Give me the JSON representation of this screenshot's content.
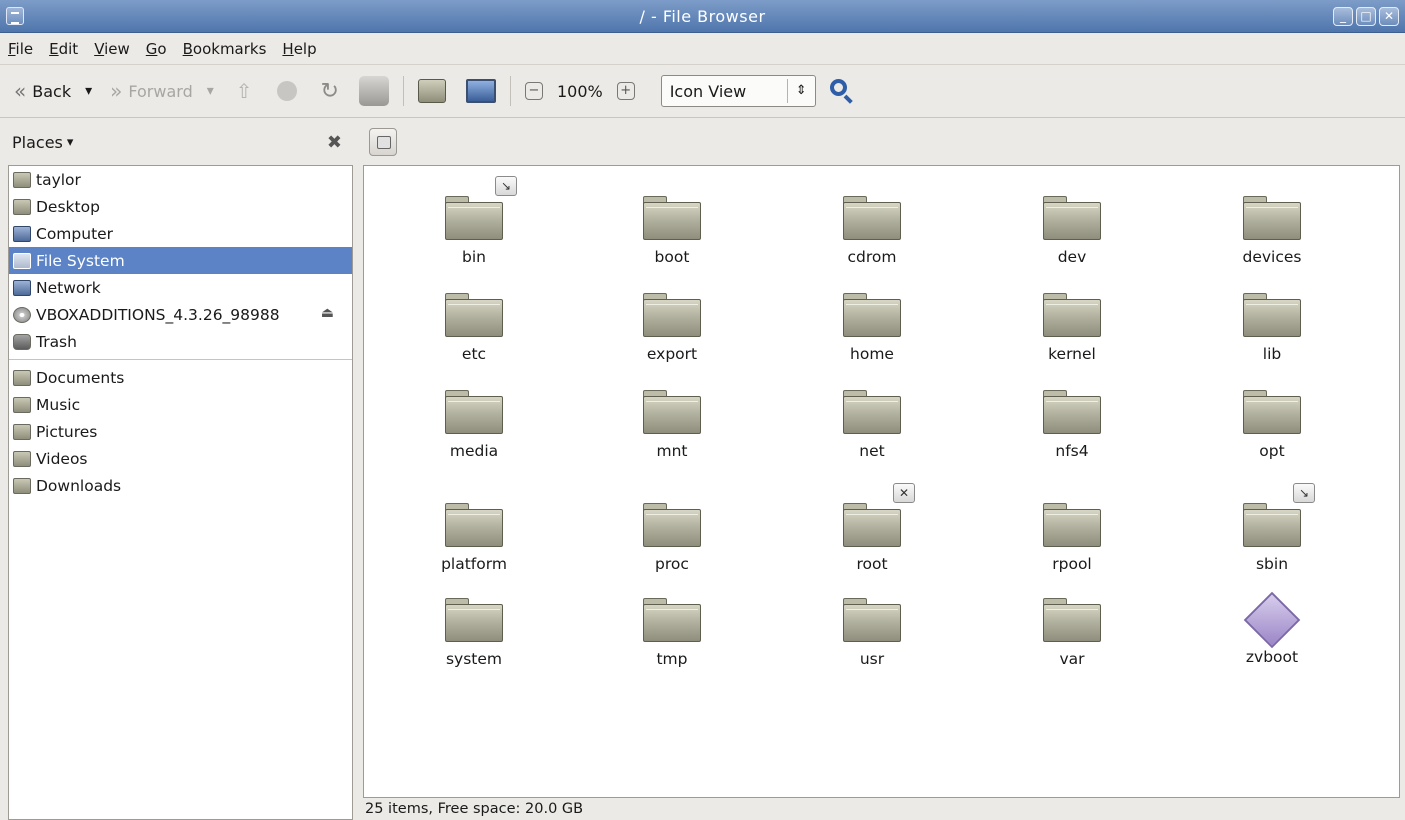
{
  "window": {
    "title": "/ - File Browser"
  },
  "menubar": [
    "File",
    "Edit",
    "View",
    "Go",
    "Bookmarks",
    "Help"
  ],
  "toolbar": {
    "back_label": "Back",
    "forward_label": "Forward",
    "zoom_level": "100%",
    "view_mode": "Icon View"
  },
  "sidebar": {
    "header": "Places",
    "places": [
      {
        "label": "taylor",
        "icon": "home-icon"
      },
      {
        "label": "Desktop",
        "icon": "desktop-folder-icon"
      },
      {
        "label": "Computer",
        "icon": "computer-icon"
      },
      {
        "label": "File System",
        "icon": "filesystem-icon",
        "selected": true
      },
      {
        "label": "Network",
        "icon": "network-icon"
      },
      {
        "label": "VBOXADDITIONS_4.3.26_98988",
        "icon": "cdrom-icon",
        "ejectable": true
      },
      {
        "label": "Trash",
        "icon": "trash-icon"
      }
    ],
    "bookmarks": [
      {
        "label": "Documents",
        "icon": "documents-folder-icon"
      },
      {
        "label": "Music",
        "icon": "music-folder-icon"
      },
      {
        "label": "Pictures",
        "icon": "pictures-folder-icon"
      },
      {
        "label": "Videos",
        "icon": "videos-folder-icon"
      },
      {
        "label": "Downloads",
        "icon": "downloads-folder-icon"
      }
    ]
  },
  "files": [
    {
      "name": "bin",
      "emblem": "symlink"
    },
    {
      "name": "boot"
    },
    {
      "name": "cdrom"
    },
    {
      "name": "dev"
    },
    {
      "name": "devices"
    },
    {
      "name": "etc"
    },
    {
      "name": "export"
    },
    {
      "name": "home"
    },
    {
      "name": "kernel"
    },
    {
      "name": "lib"
    },
    {
      "name": "media"
    },
    {
      "name": "mnt"
    },
    {
      "name": "net"
    },
    {
      "name": "nfs4"
    },
    {
      "name": "opt"
    },
    {
      "name": "platform"
    },
    {
      "name": "proc"
    },
    {
      "name": "root",
      "emblem": "unreadable"
    },
    {
      "name": "rpool"
    },
    {
      "name": "sbin",
      "emblem": "symlink"
    },
    {
      "name": "system"
    },
    {
      "name": "tmp"
    },
    {
      "name": "usr"
    },
    {
      "name": "var"
    },
    {
      "name": "zvboot",
      "type": "file"
    }
  ],
  "status": "25 items, Free space: 20.0 GB"
}
